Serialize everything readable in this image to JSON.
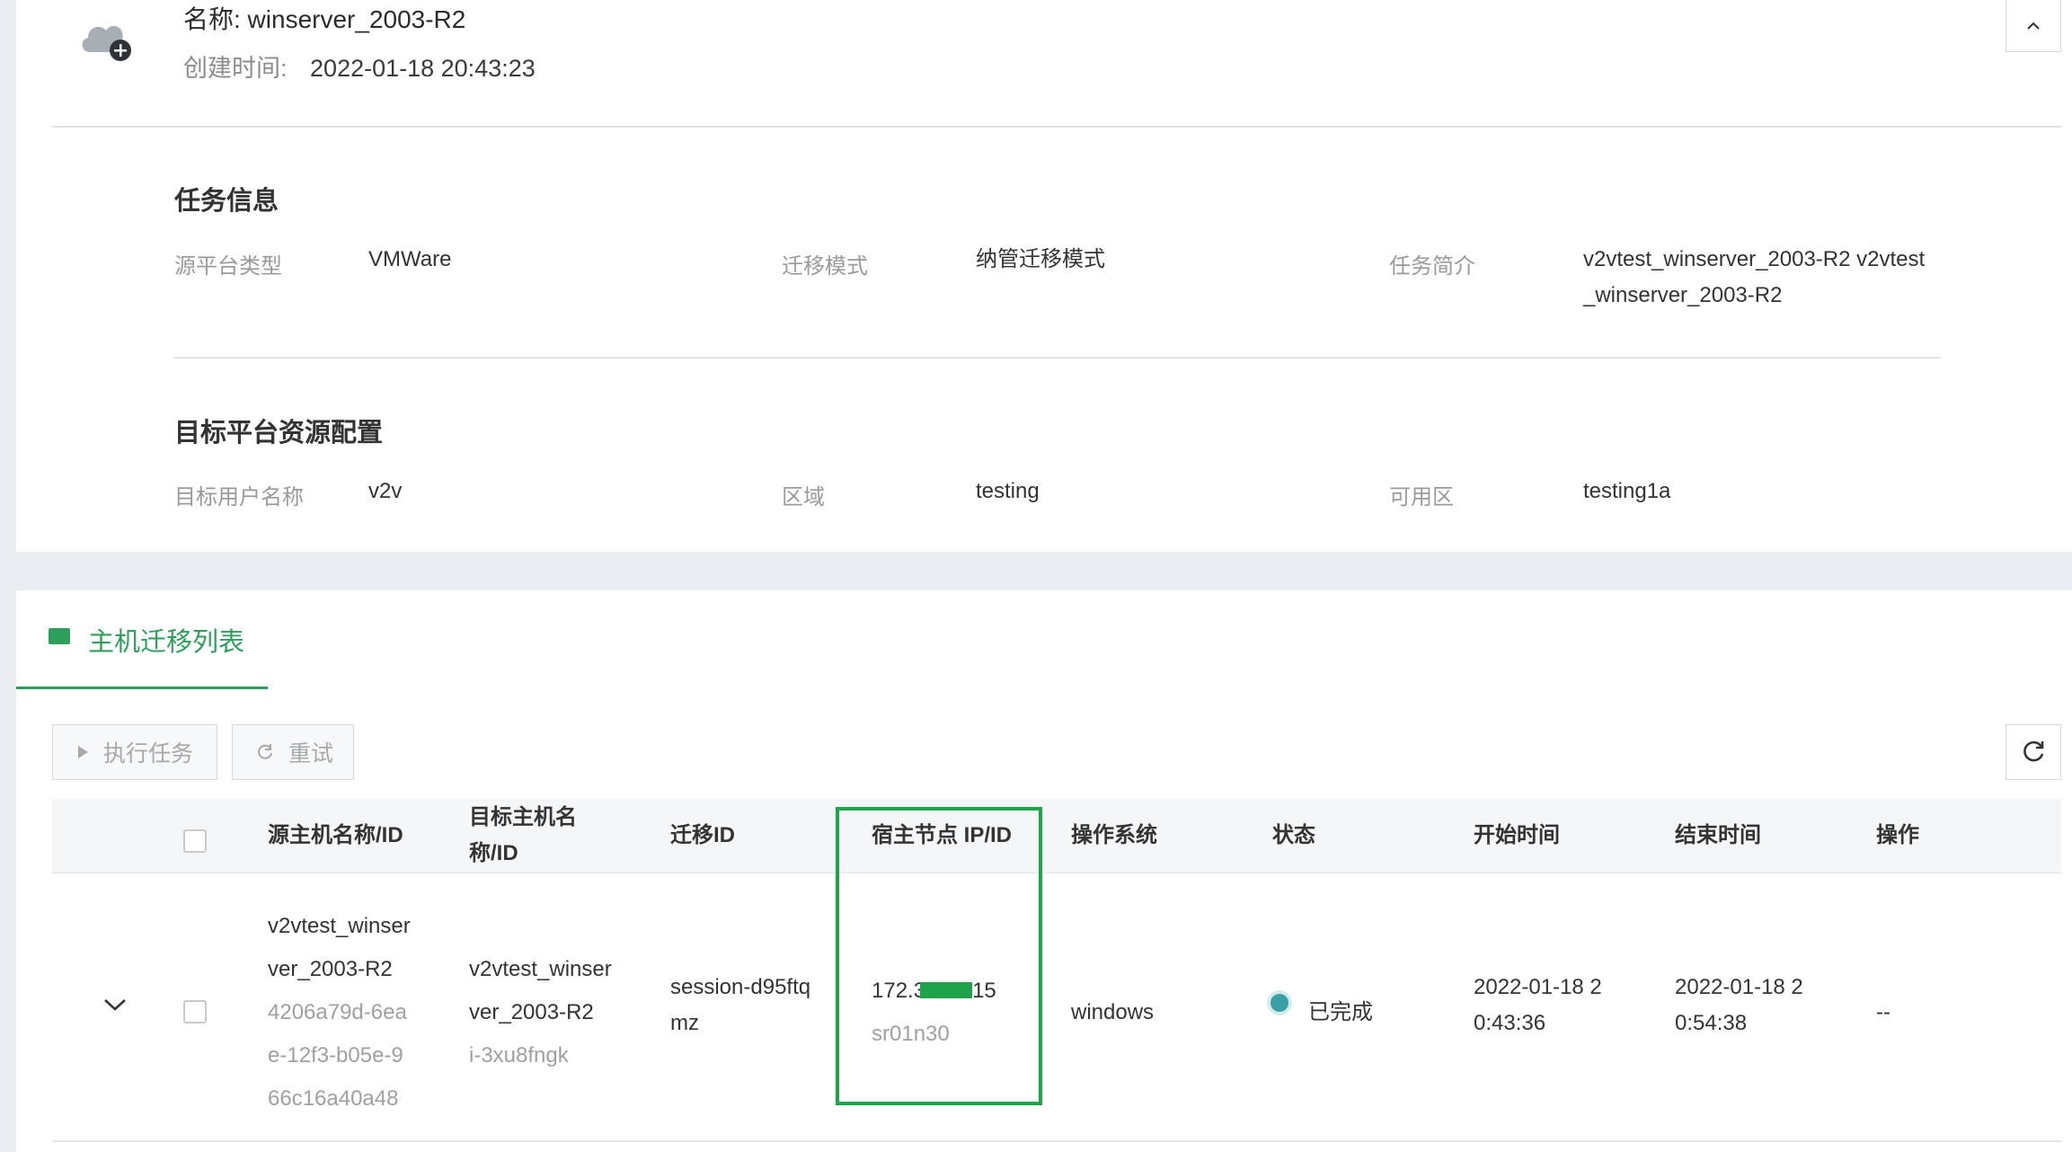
{
  "header": {
    "name": "名称: winserver_2003-R2",
    "created_label": "创建时间:",
    "created_value": "2022-01-18 20:43:23",
    "cloud_icon": "cloud-add-icon",
    "collapse_icon": "chevron-up-icon"
  },
  "task_info": {
    "title": "任务信息",
    "source_platform_label": "源平台类型",
    "source_platform_value": "VMWare",
    "migration_mode_label": "迁移模式",
    "migration_mode_value": "纳管迁移模式",
    "description_label": "任务简介",
    "description_line1": "v2vtest_winserver_2003-R2 v2vtest",
    "description_line2": "_winserver_2003-R2"
  },
  "target_config": {
    "title": "目标平台资源配置",
    "user_label": "目标用户名称",
    "user_value": "v2v",
    "region_label": "区域",
    "region_value": "testing",
    "zone_label": "可用区",
    "zone_value": "testing1a"
  },
  "list": {
    "tab_label": "主机迁移列表",
    "tab_icon": "monitor-icon",
    "execute_label": "执行任务",
    "retry_label": "重试",
    "refresh_icon": "refresh-icon",
    "columns": {
      "source_host": "源主机名称/ID",
      "target_host_1": "目标主机名",
      "target_host_2": "称/ID",
      "migration_id": "迁移ID",
      "host_node": "宿主节点 IP/ID",
      "os": "操作系统",
      "status": "状态",
      "start_time": "开始时间",
      "end_time": "结束时间",
      "actions": "操作"
    },
    "rows": [
      {
        "source_name_1": "v2vtest_winser",
        "source_name_2": "ver_2003-R2",
        "source_id_1": "4206a79d-6ea",
        "source_id_2": "e-12f3-b05e-9",
        "source_id_3": "66c16a40a48",
        "target_name_1": "v2vtest_winser",
        "target_name_2": "ver_2003-R2",
        "target_id": "i-3xu8fngk",
        "migration_id_1": "session-d95ftq",
        "migration_id_2": "mz",
        "node_ip_prefix": "172.3",
        "node_ip_suffix": "15",
        "node_id": "sr01n30",
        "os": "windows",
        "status": "已完成",
        "start_1": "2022-01-18 2",
        "start_2": "0:43:36",
        "end_1": "2022-01-18 2",
        "end_2": "0:54:38",
        "actions": "--"
      }
    ]
  }
}
